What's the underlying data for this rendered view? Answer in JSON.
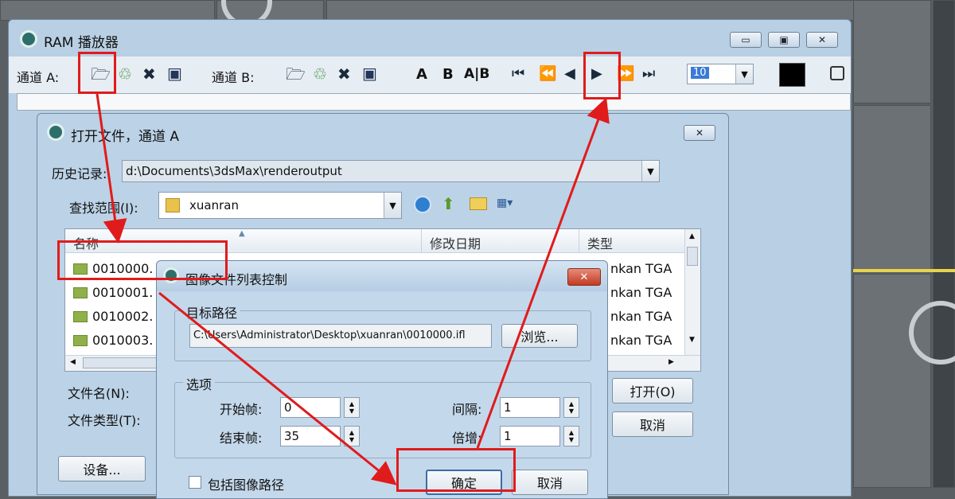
{
  "ram_window": {
    "title": "RAM 播放器",
    "channel_a_label": "通道 A:",
    "channel_b_label": "通道 B:",
    "letter_a": "A",
    "letter_b": "B",
    "letter_ab": "A|B",
    "ratio_value": "10",
    "icons": [
      "open-folder-icon",
      "load-icon",
      "close-icon",
      "save-icon",
      "first-frame-icon",
      "prev-frame-icon",
      "prev-icon",
      "play-icon",
      "next-icon",
      "last-frame-icon"
    ]
  },
  "open_dialog": {
    "title": "打开文件，通道 A",
    "history_label": "历史记录:",
    "history_value": "d:\\Documents\\3dsMax\\renderoutput",
    "lookin_label": "查找范围(I):",
    "lookin_value": "xuanran",
    "columns": {
      "name": "名称",
      "date": "修改日期",
      "type": "类型"
    },
    "files": [
      {
        "name": "0010000.",
        "type": "nkan TGA"
      },
      {
        "name": "0010001.",
        "type": "nkan TGA"
      },
      {
        "name": "0010002.",
        "type": "nkan TGA"
      },
      {
        "name": "0010003.",
        "type": "nkan TGA"
      }
    ],
    "filename_label": "文件名(N):",
    "filetype_label": "文件类型(T):",
    "open_button": "打开(O)",
    "cancel_button": "取消",
    "setup_button": "设备..."
  },
  "image_list_dialog": {
    "title": "图像文件列表控制",
    "target_group": "目标路径",
    "target_path": "C:\\Users\\Administrator\\Desktop\\xuanran\\0010000.ifl",
    "browse_button": "浏览...",
    "options_group": "选项",
    "start_label": "开始帧:",
    "start_value": "0",
    "end_label": "结束帧:",
    "end_value": "35",
    "every_label": "间隔:",
    "every_value": "1",
    "multiplier_label": "倍增:",
    "multiplier_value": "1",
    "include_path_label": "包括图像路径",
    "ok_button": "确定",
    "cancel_button": "取消"
  },
  "colors": {
    "annotation_red": "#e01b1b",
    "swatch": "#000000"
  }
}
